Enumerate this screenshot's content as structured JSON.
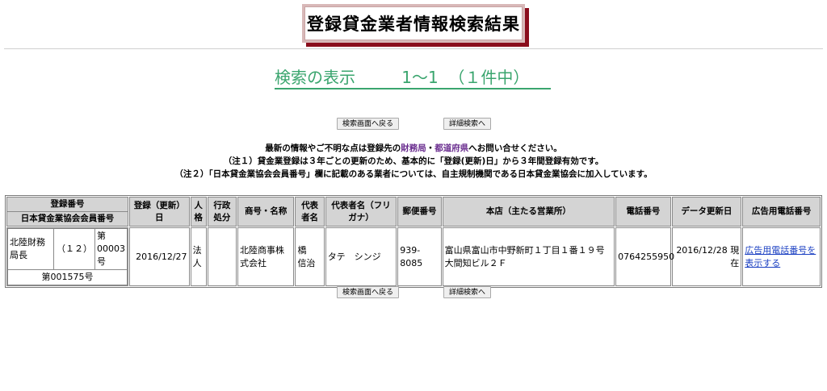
{
  "page_title": "登録貸金業者情報検索結果",
  "count": {
    "label": "検索の表示",
    "range": "1～1",
    "total": "（１件中）"
  },
  "buttons": {
    "back": "検索画面へ戻る",
    "detail": "詳細検索へ"
  },
  "notes": {
    "line1_pre": "最新の情報やご不明な点は登録先の",
    "link_zaimukyoku": "財務局",
    "sep": "・",
    "link_todofuken": "都道府県",
    "line1_post": "へお問い合せください。",
    "line2": "（注１）貸金業登録は３年ごとの更新のため、基本的に「登録(更新)日」から３年間登録有効です。",
    "line3": "（注２）「日本貸金業協会会員番号」欄に記載のある業者については、自主規制機関である日本貸金業協会に加入しています。"
  },
  "table": {
    "headers": {
      "reg_no": "登録番号",
      "member_no": "日本貸金業協会会員番号",
      "reg_date": "登録（更新）日",
      "person": "人格",
      "sanction": "行政処分",
      "name": "商号・名称",
      "rep": "代表者名",
      "rep_kana": "代表者名（フリガナ）",
      "zip": "郵便番号",
      "address": "本店（主たる営業所）",
      "tel": "電話番号",
      "updated": "データ更新日",
      "ad_tel": "広告用電話番号"
    },
    "row": {
      "reg_office": "北陸財務局長",
      "reg_count": "（１２）",
      "reg_num": "第00003号",
      "member_no": "第001575号",
      "reg_date": "2016/12/27",
      "person": "法人",
      "sanction": "",
      "name": "北陸商事株式会社",
      "rep": "橋　信治",
      "rep_kana": "タテ　シンジ",
      "zip": "939-8085",
      "address": "富山県富山市中野新町１丁目１番１９号大間知ビル２Ｆ",
      "tel": "0764255950",
      "updated": "2016/12/28 現在",
      "ad_tel": "広告用電話番号を表示する"
    }
  }
}
